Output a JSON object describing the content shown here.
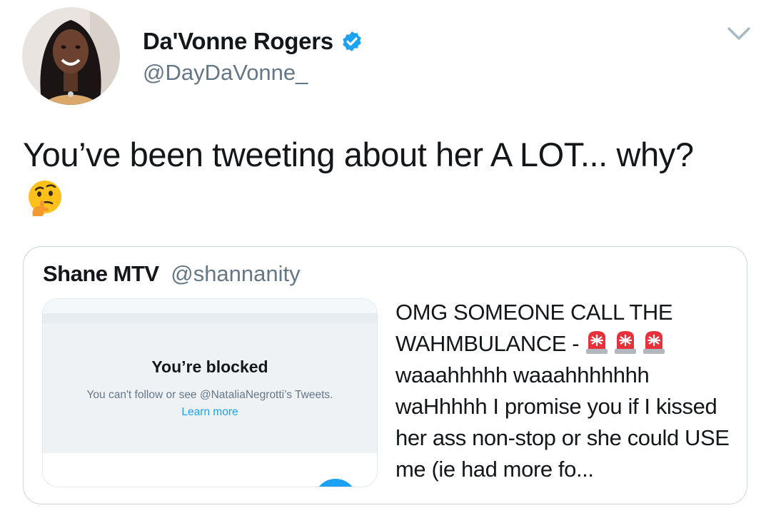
{
  "author": {
    "display_name": "Da'Vonne Rogers",
    "handle": "@DayDaVonne_",
    "verified": true,
    "avatar_icon": "profile-photo"
  },
  "tweet": {
    "text": "You’ve been tweeting about her A LOT... why?",
    "emoji": "thinking-face"
  },
  "menu": {
    "icon": "chevron-down-icon"
  },
  "quoted_tweet": {
    "display_name": "Shane MTV",
    "handle": "@shannanity",
    "text_before_emoji": "OMG SOMEONE CALL THE WAHMBULANCE -",
    "emoji": "police-car-light",
    "emoji_count": 3,
    "text_after_emoji": "waaahhhhh waaahhhhhhh waHhhhh I promise you if I kissed her ass non-stop or she could USE me (ie had more fo...",
    "media": {
      "title": "You’re blocked",
      "description": "You can't follow or see @NataliaNegrotti’s Tweets.",
      "link": "Learn more"
    }
  },
  "colors": {
    "text": "#14171a",
    "secondary": "#657786",
    "accent": "#1da1f2",
    "border": "#ccd6dd"
  }
}
